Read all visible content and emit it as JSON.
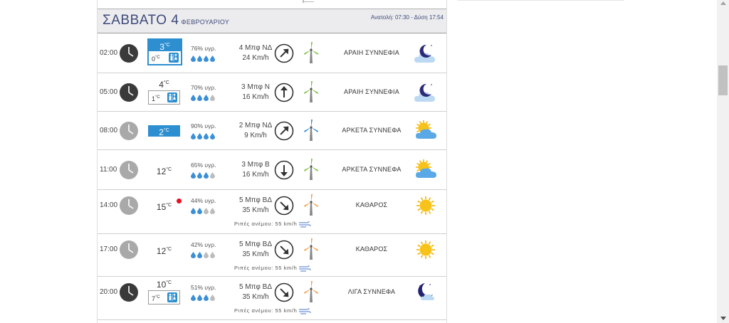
{
  "day": {
    "title": "ΣΑΒΒΑΤΟ 4",
    "month": "ΦΕΒΡΟΥΑΡΙΟΥ",
    "sun_times": "Ανατολή: 07:30  - Δύση 17:54"
  },
  "rows": [
    {
      "time": "02:00",
      "clock": "dark",
      "temp": "3",
      "temp_unit": "°C",
      "min_temp": "0",
      "min_unit": "°C",
      "highlight": true,
      "outlined": true,
      "humidity": "76% υγρ.",
      "drops_filled": 4,
      "wind_bft": "4 Μπφ ΝΔ",
      "wind_kmh": "24 Km/h",
      "wind_dir": "NE",
      "turbine": "green",
      "condition": "ΑΡΑΙΗ ΣΥΝΝΕΦΙΑ",
      "weather_icon": "night-partly-cloudy"
    },
    {
      "time": "05:00",
      "clock": "dark",
      "temp": "4",
      "temp_unit": "°C",
      "min_temp": "1",
      "min_unit": "°C",
      "highlight": false,
      "outlined": false,
      "humidity": "70% υγρ.",
      "drops_filled": 3,
      "wind_bft": "3 Μπφ Ν",
      "wind_kmh": "16 Km/h",
      "wind_dir": "N",
      "turbine": "green",
      "condition": "ΑΡΑΙΗ ΣΥΝΝΕΦΙΑ",
      "weather_icon": "night-partly-cloudy"
    },
    {
      "time": "08:00",
      "clock": "light",
      "temp": "2",
      "temp_unit": "°C",
      "highlight": true,
      "outlined": false,
      "humidity": "90% υγρ.",
      "drops_filled": 4,
      "wind_bft": "2 Μπφ ΝΔ",
      "wind_kmh": "9 Km/h",
      "wind_dir": "NE",
      "turbine": "blue",
      "condition": "ΑΡΚΕΤΑ ΣΥΝΝΕΦΑ",
      "weather_icon": "day-cloudy"
    },
    {
      "time": "11:00",
      "clock": "light",
      "temp": "12",
      "temp_unit": "°C",
      "highlight": false,
      "outlined": false,
      "humidity": "65% υγρ.",
      "drops_filled": 3,
      "wind_bft": "3 Μπφ Β",
      "wind_kmh": "16 Km/h",
      "wind_dir": "S",
      "turbine": "green",
      "condition": "ΑΡΚΕΤΑ ΣΥΝΝΕΦΑ",
      "weather_icon": "day-cloudy"
    },
    {
      "time": "14:00",
      "clock": "light",
      "temp": "15",
      "temp_unit": "°C",
      "highlight": false,
      "outlined": false,
      "red_dot": true,
      "humidity": "44% υγρ.",
      "drops_filled": 2,
      "wind_bft": "5 Μπφ ΒΔ",
      "wind_kmh": "35 Km/h",
      "wind_dir": "SE",
      "turbine": "orange",
      "condition": "ΚΑΘΑΡΟΣ",
      "weather_icon": "sun",
      "gust": "Ριπές ανέμου: 55 km/h"
    },
    {
      "time": "17:00",
      "clock": "light",
      "temp": "12",
      "temp_unit": "°C",
      "highlight": false,
      "outlined": false,
      "humidity": "42% υγρ.",
      "drops_filled": 2,
      "wind_bft": "5 Μπφ ΒΔ",
      "wind_kmh": "35 Km/h",
      "wind_dir": "SE",
      "turbine": "orange",
      "condition": "ΚΑΘΑΡΟΣ",
      "weather_icon": "sun",
      "gust": "Ριπές ανέμου: 55 km/h"
    },
    {
      "time": "20:00",
      "clock": "dark",
      "temp": "10",
      "temp_unit": "°C",
      "min_temp": "7",
      "min_unit": "°C",
      "highlight": false,
      "outlined": false,
      "humidity": "51% υγρ.",
      "drops_filled": 3,
      "wind_bft": "5 Μπφ ΒΔ",
      "wind_kmh": "35 Km/h",
      "wind_dir": "SE",
      "turbine": "orange",
      "condition": "ΛΙΓΑ ΣΥΝΝΕΦΑ",
      "weather_icon": "night-few-clouds",
      "gust": "Ριπές ανέμου: 55 km/h"
    }
  ],
  "colors": {
    "highlight": "#2e8fd0",
    "title": "#3e4a78",
    "turbine_green": "#7cc243",
    "turbine_blue": "#3a8fd6",
    "turbine_orange": "#f0a050",
    "red_dot": "#e8101f"
  }
}
